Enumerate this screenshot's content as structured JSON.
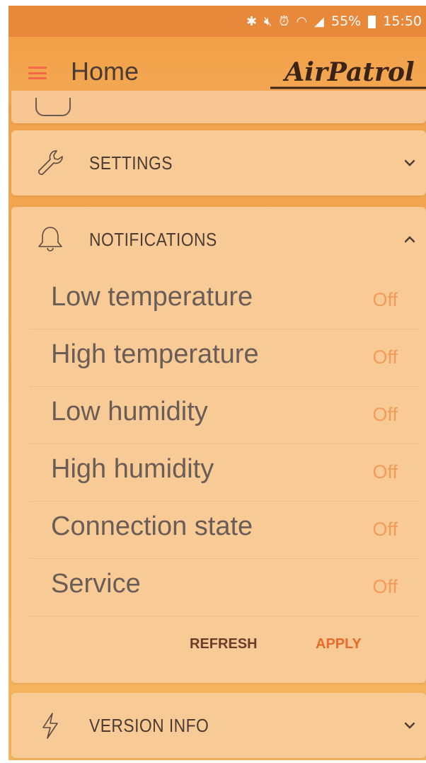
{
  "status_bar": {
    "icons": [
      "bluetooth-icon",
      "mute-icon",
      "alarm-icon",
      "wifi-icon",
      "signal-icon"
    ],
    "battery": "55%",
    "time": "15:50"
  },
  "app_bar": {
    "title": "Home",
    "logo_text": "AirPatrol"
  },
  "sections": {
    "settings": {
      "title": "SETTINGS",
      "expanded": false
    },
    "notifications": {
      "title": "NOTIFICATIONS",
      "expanded": true,
      "items": [
        {
          "label": "Low temperature",
          "value": "Off"
        },
        {
          "label": "High temperature",
          "value": "Off"
        },
        {
          "label": "Low humidity",
          "value": "Off"
        },
        {
          "label": "High humidity",
          "value": "Off"
        },
        {
          "label": "Connection state",
          "value": "Off"
        },
        {
          "label": "Service",
          "value": "Off"
        }
      ],
      "refresh_label": "REFRESH",
      "apply_label": "APPLY"
    },
    "version_info": {
      "title": "VERSION INFO",
      "expanded": false
    }
  },
  "colors": {
    "status_bar": "#e7883a",
    "app_bar": "#f2a24c",
    "card": "#f8cb96",
    "accent": "#ea6a2a",
    "value_off": "#f39b5a",
    "text": "#4a3b34"
  }
}
